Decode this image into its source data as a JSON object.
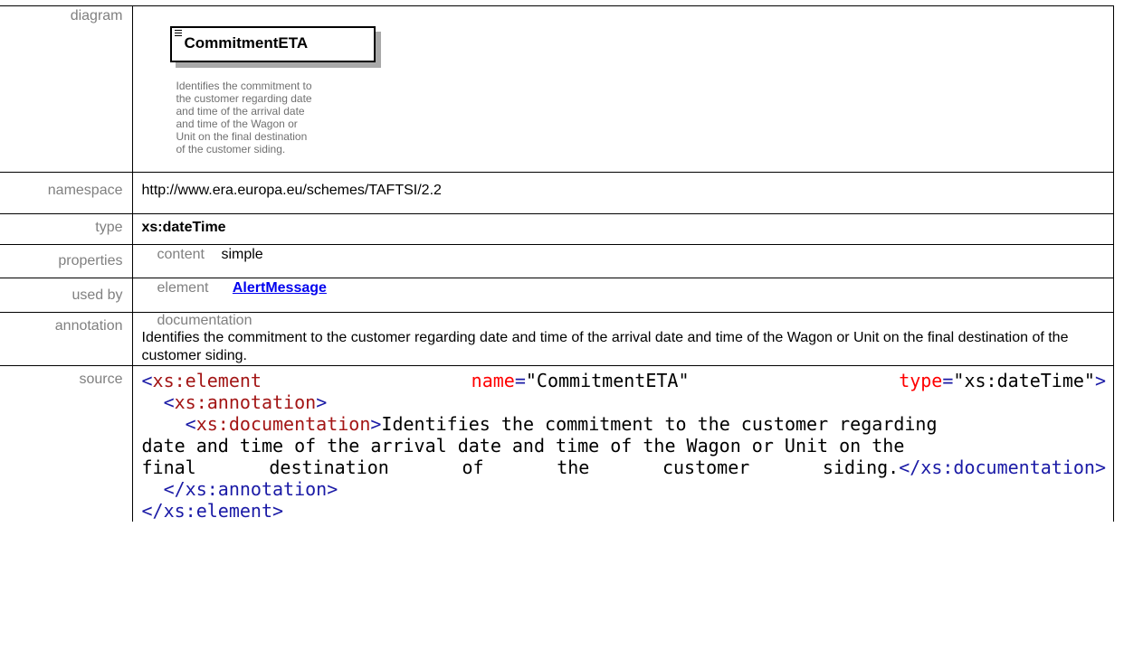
{
  "rows": {
    "diagram_label": "diagram",
    "namespace_label": "namespace",
    "type_label": "type",
    "properties_label": "properties",
    "usedby_label": "used by",
    "annotation_label": "annotation",
    "source_label": "source"
  },
  "diagram": {
    "element_name": "CommitmentETA",
    "documentation_lines": [
      "Identifies the commitment to",
      "the customer regarding date",
      "and time of the arrival date",
      "and time of the Wagon or",
      "Unit on the final destination",
      "of the customer siding."
    ]
  },
  "namespace": "http://www.era.europa.eu/schemes/TAFTSI/2.2",
  "type": "xs:dateTime",
  "properties": {
    "key": "content",
    "value": "simple"
  },
  "used_by": {
    "key": "element",
    "link": "AlertMessage"
  },
  "annotation": {
    "key": "documentation",
    "text": "Identifies the commitment to the customer regarding date and time of the arrival date and time of the Wagon or Unit on the final destination of the customer siding."
  },
  "source": {
    "open_tag": "xs:element",
    "attr_name": "name",
    "attr_name_value": "\"CommitmentETA\"",
    "attr_type": "type",
    "attr_type_value": "\"xs:dateTime\"",
    "annotation_tag": "xs:annotation",
    "documentation_tag": "xs:documentation",
    "doc_line1": "Identifies the commitment to the customer regarding",
    "doc_line2": "date and time of the arrival date and time of the Wagon or Unit on the",
    "doc_line3_words": [
      "final",
      "destination",
      "of",
      "the",
      "customer",
      "siding."
    ],
    "close_documentation": "</xs:documentation>",
    "close_annotation": "</xs:annotation>",
    "close_element": "</xs:element>"
  },
  "colors": {
    "label_gray": "#808080",
    "link_blue": "#0000ee",
    "xml_bracket": "#1a1aa6",
    "xml_tag": "#a31515",
    "xml_attr": "#ff0000"
  }
}
